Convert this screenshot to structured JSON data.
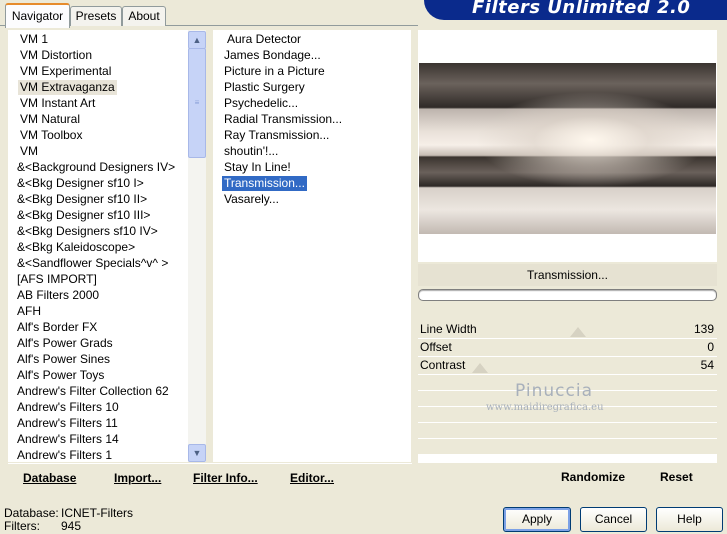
{
  "tabs": [
    "Navigator",
    "Presets",
    "About"
  ],
  "app_title": "Filters Unlimited 2.0",
  "categories": [
    "VM 1",
    "VM Distortion",
    "VM Experimental",
    "VM Extravaganza",
    "VM Instant Art",
    "VM Natural",
    "VM Toolbox",
    "VM",
    "&<Background Designers IV>",
    "&<Bkg Designer sf10 I>",
    "&<Bkg Designer sf10 II>",
    "&<Bkg Designer sf10 III>",
    "&<Bkg Designers sf10 IV>",
    "&<Bkg Kaleidoscope>",
    "&<Sandflower Specials^v^ >",
    "[AFS IMPORT]",
    "AB Filters 2000",
    "AFH",
    "Alf's Border FX",
    "Alf's Power Grads",
    "Alf's Power Sines",
    "Alf's Power Toys",
    "Andrew's Filter Collection 62",
    "Andrew's Filters 10",
    "Andrew's Filters 11",
    "Andrew's Filters 14",
    "Andrew's Filters 1"
  ],
  "selected_category": "VM Extravaganza",
  "filters": [
    "Aura Detector",
    "James Bondage...",
    "Picture in a Picture",
    "Plastic Surgery",
    "Psychedelic...",
    "Radial Transmission...",
    "Ray Transmission...",
    "shoutin'!...",
    "Stay In Line!",
    "Transmission...",
    "Vasarely..."
  ],
  "selected_filter": "Transmission...",
  "left_links": {
    "database": "Database",
    "import": "Import...",
    "filter_info": "Filter Info...",
    "editor": "Editor..."
  },
  "preview_label": "Transmission...",
  "params": [
    {
      "name": "Line Width",
      "value": "139"
    },
    {
      "name": "Offset",
      "value": "0"
    },
    {
      "name": "Contrast",
      "value": "54"
    }
  ],
  "watermark": {
    "line1": "Pinuccia",
    "line2": "www.maidiregrafica.eu"
  },
  "right_links": {
    "randomize": "Randomize",
    "reset": "Reset"
  },
  "status": {
    "database_label": "Database:",
    "database_value": "ICNET-Filters",
    "filters_label": "Filters:",
    "filters_value": "945"
  },
  "buttons": {
    "apply": "Apply",
    "cancel": "Cancel",
    "help": "Help"
  },
  "icons": {
    "scroll_up": "chevron-up-icon",
    "scroll_down": "chevron-down-icon",
    "thumb_grip": "grip-icon"
  }
}
